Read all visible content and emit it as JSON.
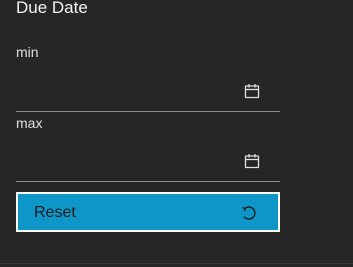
{
  "filter": {
    "title": "Due Date",
    "min": {
      "label": "min",
      "value": "",
      "icon": "calendar-icon"
    },
    "max": {
      "label": "max",
      "value": "",
      "icon": "calendar-icon"
    },
    "reset": {
      "label": "Reset",
      "icon": "reset-icon"
    }
  },
  "colors": {
    "background": "#262626",
    "accent": "#0f96c8",
    "underline": "#8d8d8d",
    "text": "#f4f4f4"
  }
}
